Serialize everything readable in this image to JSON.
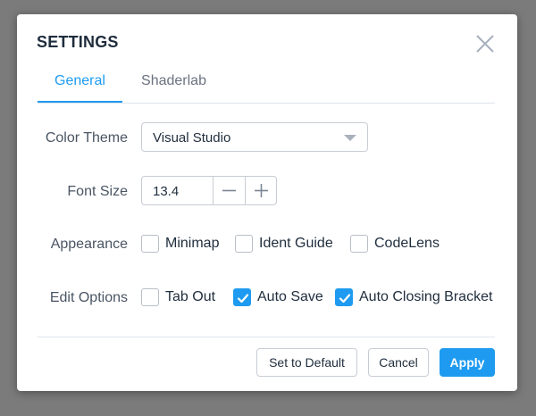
{
  "dialog": {
    "title": "SETTINGS"
  },
  "tabs": [
    {
      "label": "General",
      "active": true
    },
    {
      "label": "Shaderlab",
      "active": false
    }
  ],
  "color_theme": {
    "label": "Color Theme",
    "value": "Visual Studio"
  },
  "font_size": {
    "label": "Font Size",
    "value": "13.4"
  },
  "appearance": {
    "label": "Appearance",
    "options": [
      {
        "label": "Minimap",
        "checked": false
      },
      {
        "label": "Ident Guide",
        "checked": false
      },
      {
        "label": "CodeLens",
        "checked": false
      }
    ]
  },
  "edit_options": {
    "label": "Edit Options",
    "options": [
      {
        "label": "Tab Out",
        "checked": false
      },
      {
        "label": "Auto Save",
        "checked": true
      },
      {
        "label": "Auto Closing Bracket",
        "checked": true
      }
    ]
  },
  "footer": {
    "default_label": "Set to Default",
    "cancel_label": "Cancel",
    "apply_label": "Apply"
  },
  "colors": {
    "accent": "#1e9bf0",
    "backdrop": "#7b7b7b",
    "title_text": "#1f2d3d"
  },
  "icons": {
    "close": "close-icon",
    "dropdown": "caret-down-icon",
    "minus": "minus-icon",
    "plus": "plus-icon",
    "check": "checkmark-icon"
  }
}
